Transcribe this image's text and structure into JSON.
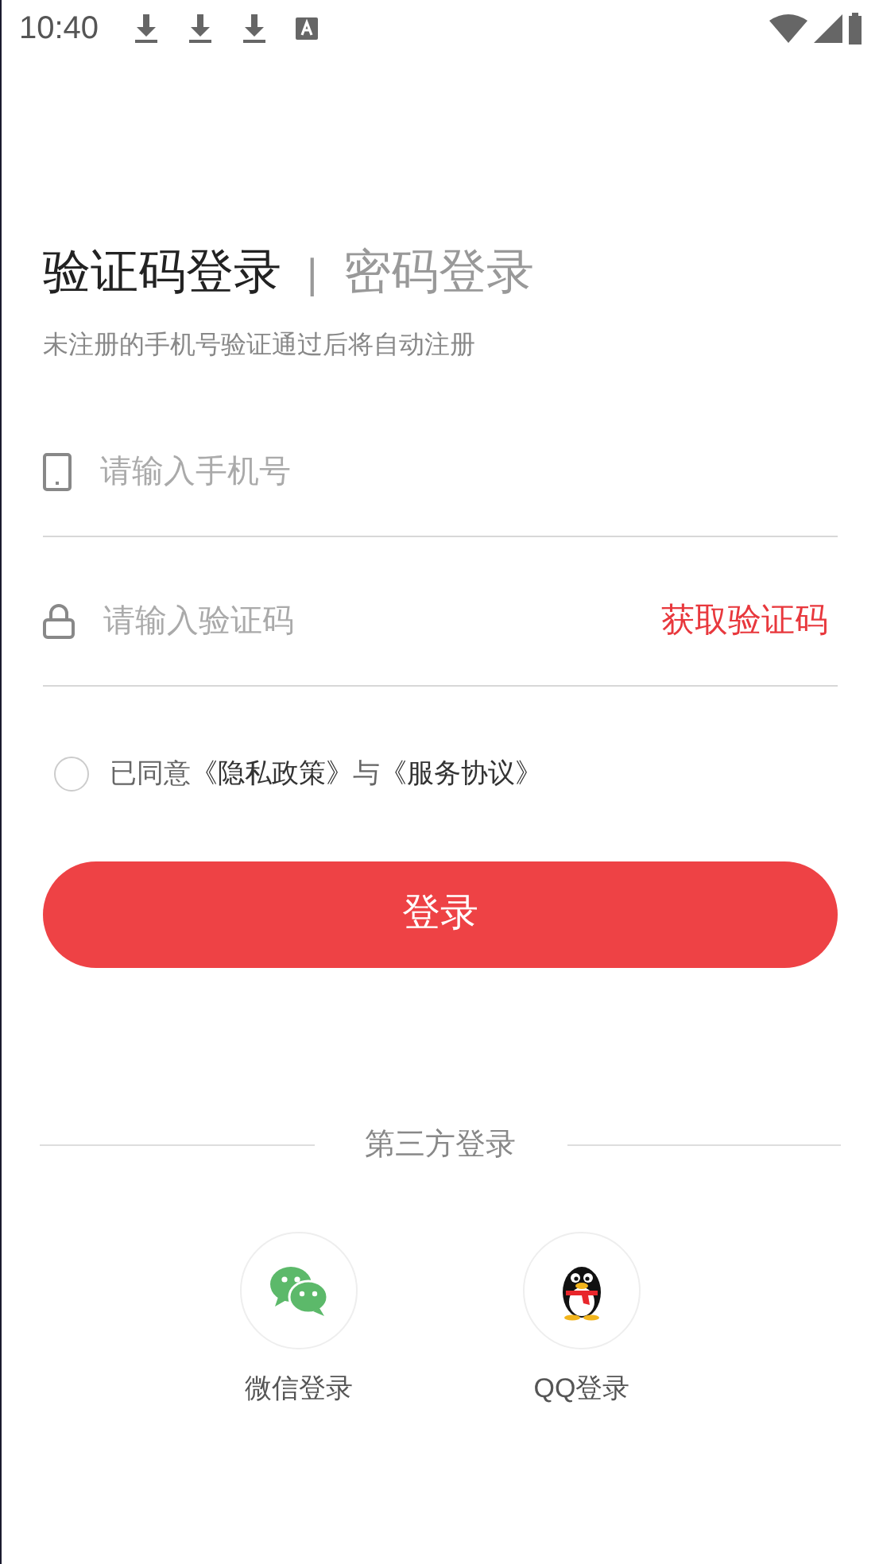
{
  "status_bar": {
    "time": "10:40"
  },
  "tabs": [
    {
      "label": "验证码登录",
      "selected": true
    },
    {
      "label": "密码登录",
      "selected": false
    }
  ],
  "tab_separator": "|",
  "subtitle": "未注册的手机号验证通过后将自动注册",
  "phone_field": {
    "placeholder": "请输入手机号"
  },
  "code_field": {
    "placeholder": "请输入验证码",
    "action": "获取验证码"
  },
  "agreement": {
    "checked": false,
    "text": "已同意",
    "privacy_link": "《隐私政策》",
    "joiner": "与",
    "service_link": "《服务协议》"
  },
  "login_button": "登录",
  "third_party": {
    "title": "第三方登录",
    "options": [
      {
        "kind": "wechat",
        "label": "微信登录"
      },
      {
        "kind": "qq",
        "label": "QQ登录"
      }
    ]
  }
}
